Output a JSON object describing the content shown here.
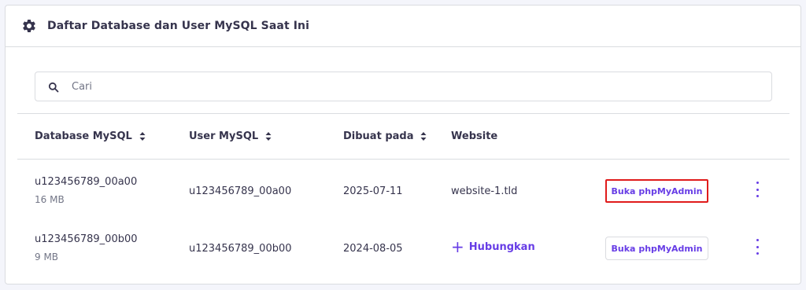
{
  "header": {
    "title": "Daftar Database dan User MySQL Saat Ini",
    "icon": "gear-icon"
  },
  "search": {
    "placeholder": "Cari",
    "value": ""
  },
  "table": {
    "columns": [
      "Database MySQL",
      "User MySQL",
      "Dibuat pada",
      "Website"
    ],
    "rows": [
      {
        "database": "u123456789_00a00",
        "size": "16 MB",
        "user": "u123456789_00a00",
        "created": "2025-07-11",
        "website": "website-1.tld",
        "action": "Buka phpMyAdmin"
      },
      {
        "database": "u123456789_00b00",
        "size": "9 MB",
        "user": "u123456789_00b00",
        "created": "2024-08-05",
        "connect": "Hubungkan",
        "action": "Buka phpMyAdmin"
      }
    ]
  },
  "colors": {
    "accent": "#673de6",
    "highlight": "#e01b1b",
    "text": "#36344d",
    "muted": "#727586"
  }
}
